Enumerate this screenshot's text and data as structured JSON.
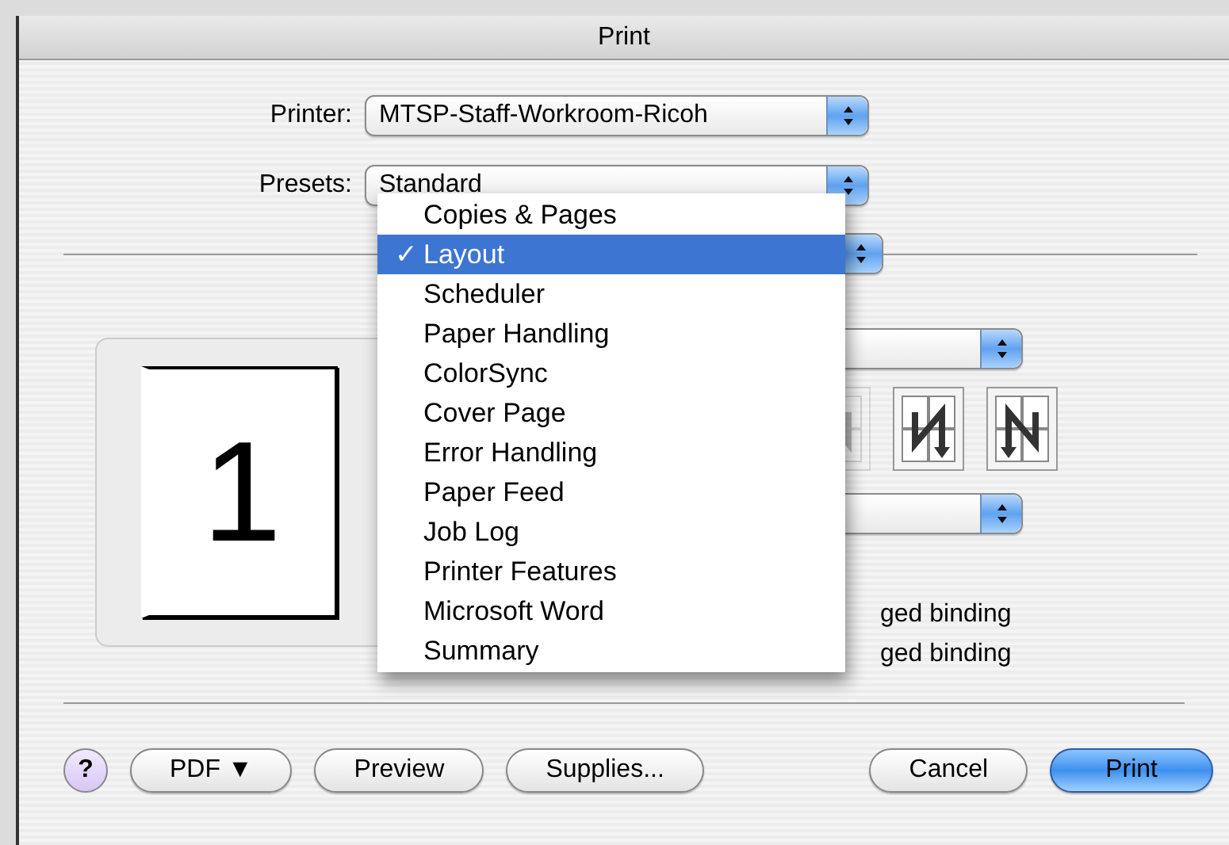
{
  "window": {
    "title": "Print"
  },
  "printer": {
    "label": "Printer:",
    "value": "MTSP-Staff-Workroom-Ricoh"
  },
  "presets": {
    "label": "Presets:",
    "value": "Standard"
  },
  "panel_menu": {
    "check": "✓",
    "items": [
      {
        "label": "Copies & Pages",
        "selected": false
      },
      {
        "label": "Layout",
        "selected": true
      },
      {
        "label": "Scheduler",
        "selected": false
      },
      {
        "label": "Paper Handling",
        "selected": false
      },
      {
        "label": "ColorSync",
        "selected": false
      },
      {
        "label": "Cover Page",
        "selected": false
      },
      {
        "label": "Error Handling",
        "selected": false
      },
      {
        "label": "Paper Feed",
        "selected": false
      },
      {
        "label": "Job Log",
        "selected": false
      },
      {
        "label": "Printer Features",
        "selected": false
      },
      {
        "label": "Microsoft Word",
        "selected": false
      },
      {
        "label": "Summary",
        "selected": false
      }
    ]
  },
  "preview": {
    "page_number": "1"
  },
  "two_sided": {
    "options": [
      {
        "label": "ged binding"
      },
      {
        "label": "ged binding"
      }
    ]
  },
  "help": "?",
  "buttons": [
    {
      "label": "PDF ▼",
      "default": false
    },
    {
      "label": "Preview",
      "default": false
    },
    {
      "label": "Supplies...",
      "default": false
    },
    {
      "label": "Cancel",
      "default": false
    },
    {
      "label": "Print",
      "default": true
    }
  ]
}
